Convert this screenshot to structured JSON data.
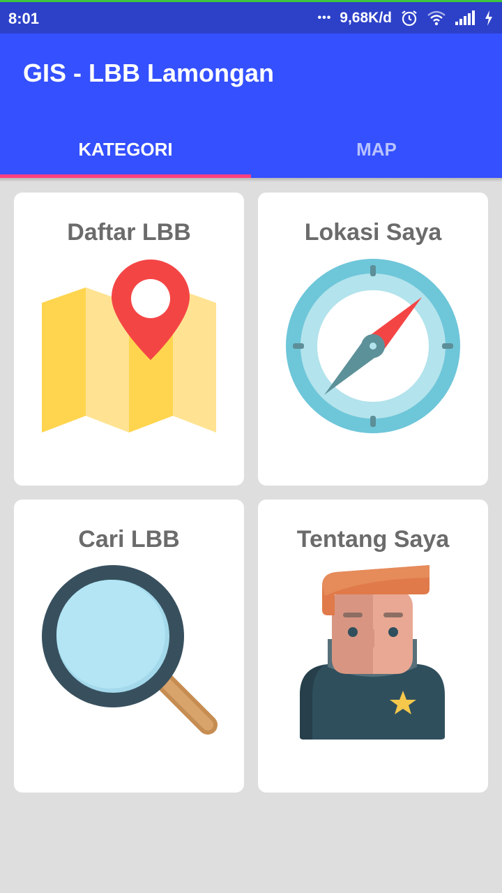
{
  "status": {
    "time": "8:01",
    "dots": "•••",
    "speed": "9,68K/d",
    "icons": [
      "alarm-icon",
      "wifi-icon",
      "signal-icon",
      "charging-icon"
    ]
  },
  "appbar": {
    "title": "GIS - LBB Lamongan"
  },
  "tabs": [
    {
      "label": "KATEGORI",
      "active": true
    },
    {
      "label": "MAP",
      "active": false
    }
  ],
  "cards": [
    {
      "label": "Daftar LBB",
      "icon": "folded-map-pin-icon"
    },
    {
      "label": "Lokasi Saya",
      "icon": "compass-icon"
    },
    {
      "label": "Cari LBB",
      "icon": "magnifier-icon"
    },
    {
      "label": "Tentang Saya",
      "icon": "person-avatar-icon"
    }
  ],
  "colors": {
    "primary": "#3450ff",
    "statusbar": "#2d41c8",
    "accent": "#ff4081",
    "background": "#dedede"
  }
}
